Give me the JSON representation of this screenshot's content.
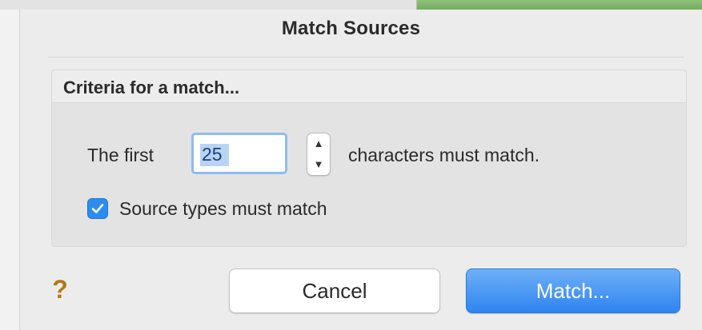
{
  "dialog": {
    "title": "Match Sources",
    "criteria_header": "Criteria for a match...",
    "first_label": "The first",
    "chars_value": "25",
    "chars_suffix": "characters must match.",
    "source_types_label": "Source types must match",
    "source_types_checked": true,
    "help_symbol": "?",
    "cancel_label": "Cancel",
    "match_label": "Match..."
  },
  "colors": {
    "accent": "#2e84ef",
    "checkbox": "#2d8cf0",
    "help": "#b07a14"
  },
  "icons": {
    "stepper": "stepper-arrows-icon",
    "checkbox": "checkmark-icon",
    "help": "help-icon"
  }
}
